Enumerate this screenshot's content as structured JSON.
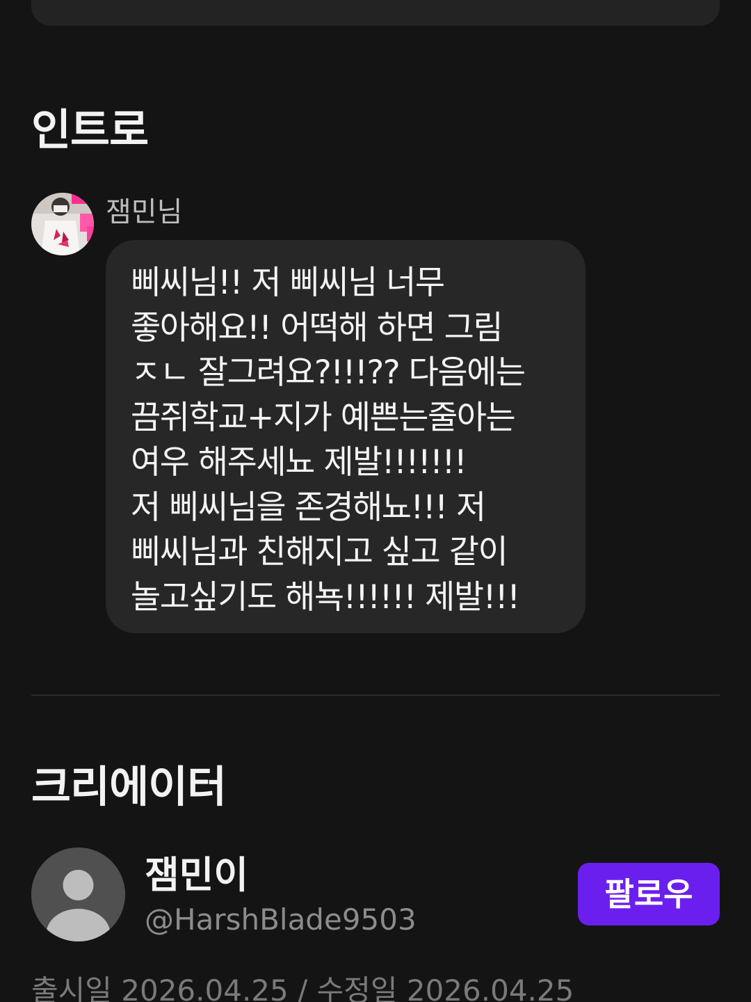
{
  "intro": {
    "title": "인트로",
    "author": "잼민님",
    "message": "삐씨님!! 저 삐씨님 너무\n좋아해요!! 어떡해 하면 그림\nㅈㄴ 잘그려요?!!!?? 다음에는\n끔쥐학교+지가 예쁜는줄아는\n여우 해주세뇨 제발!!!!!!!\n저 삐씨님을 존경해뇨!!! 저\n삐씨님과 친해지고 싶고 같이\n놀고싶기도 해뇩!!!!!! 제발!!!"
  },
  "creator": {
    "title": "크리에이터",
    "name": "잼민이",
    "handle": "@HarshBlade9503",
    "follow_label": "팔로우",
    "avatar_icon": "default-user-icon"
  },
  "dates": {
    "text": "출시일 2026.04.25 / 수정일 2026.04.25"
  },
  "colors": {
    "background": "#141414",
    "bubble": "#272727",
    "follow_button": "#6b1fef",
    "handle": "#8c8c8c"
  }
}
